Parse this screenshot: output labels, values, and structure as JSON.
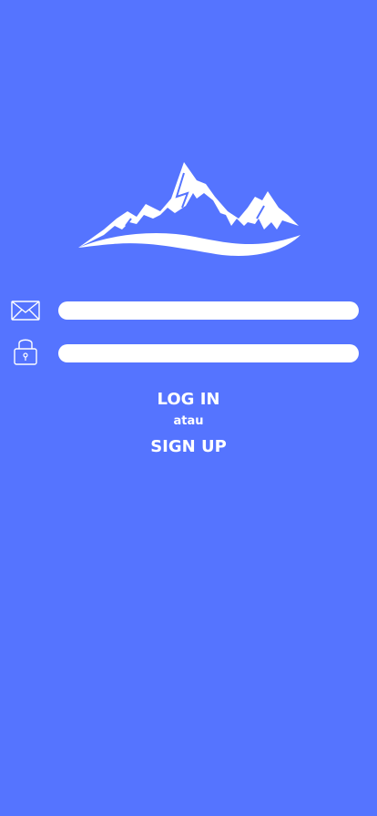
{
  "icons": {
    "logo": "mountain-logo",
    "email": "mail-icon",
    "password": "lock-icon"
  },
  "colors": {
    "background": "#5574ff",
    "foreground": "#ffffff"
  },
  "form": {
    "email_value": "",
    "password_value": ""
  },
  "actions": {
    "login_label": "LOG IN",
    "separator": "atau",
    "signup_label": "SIGN UP"
  }
}
